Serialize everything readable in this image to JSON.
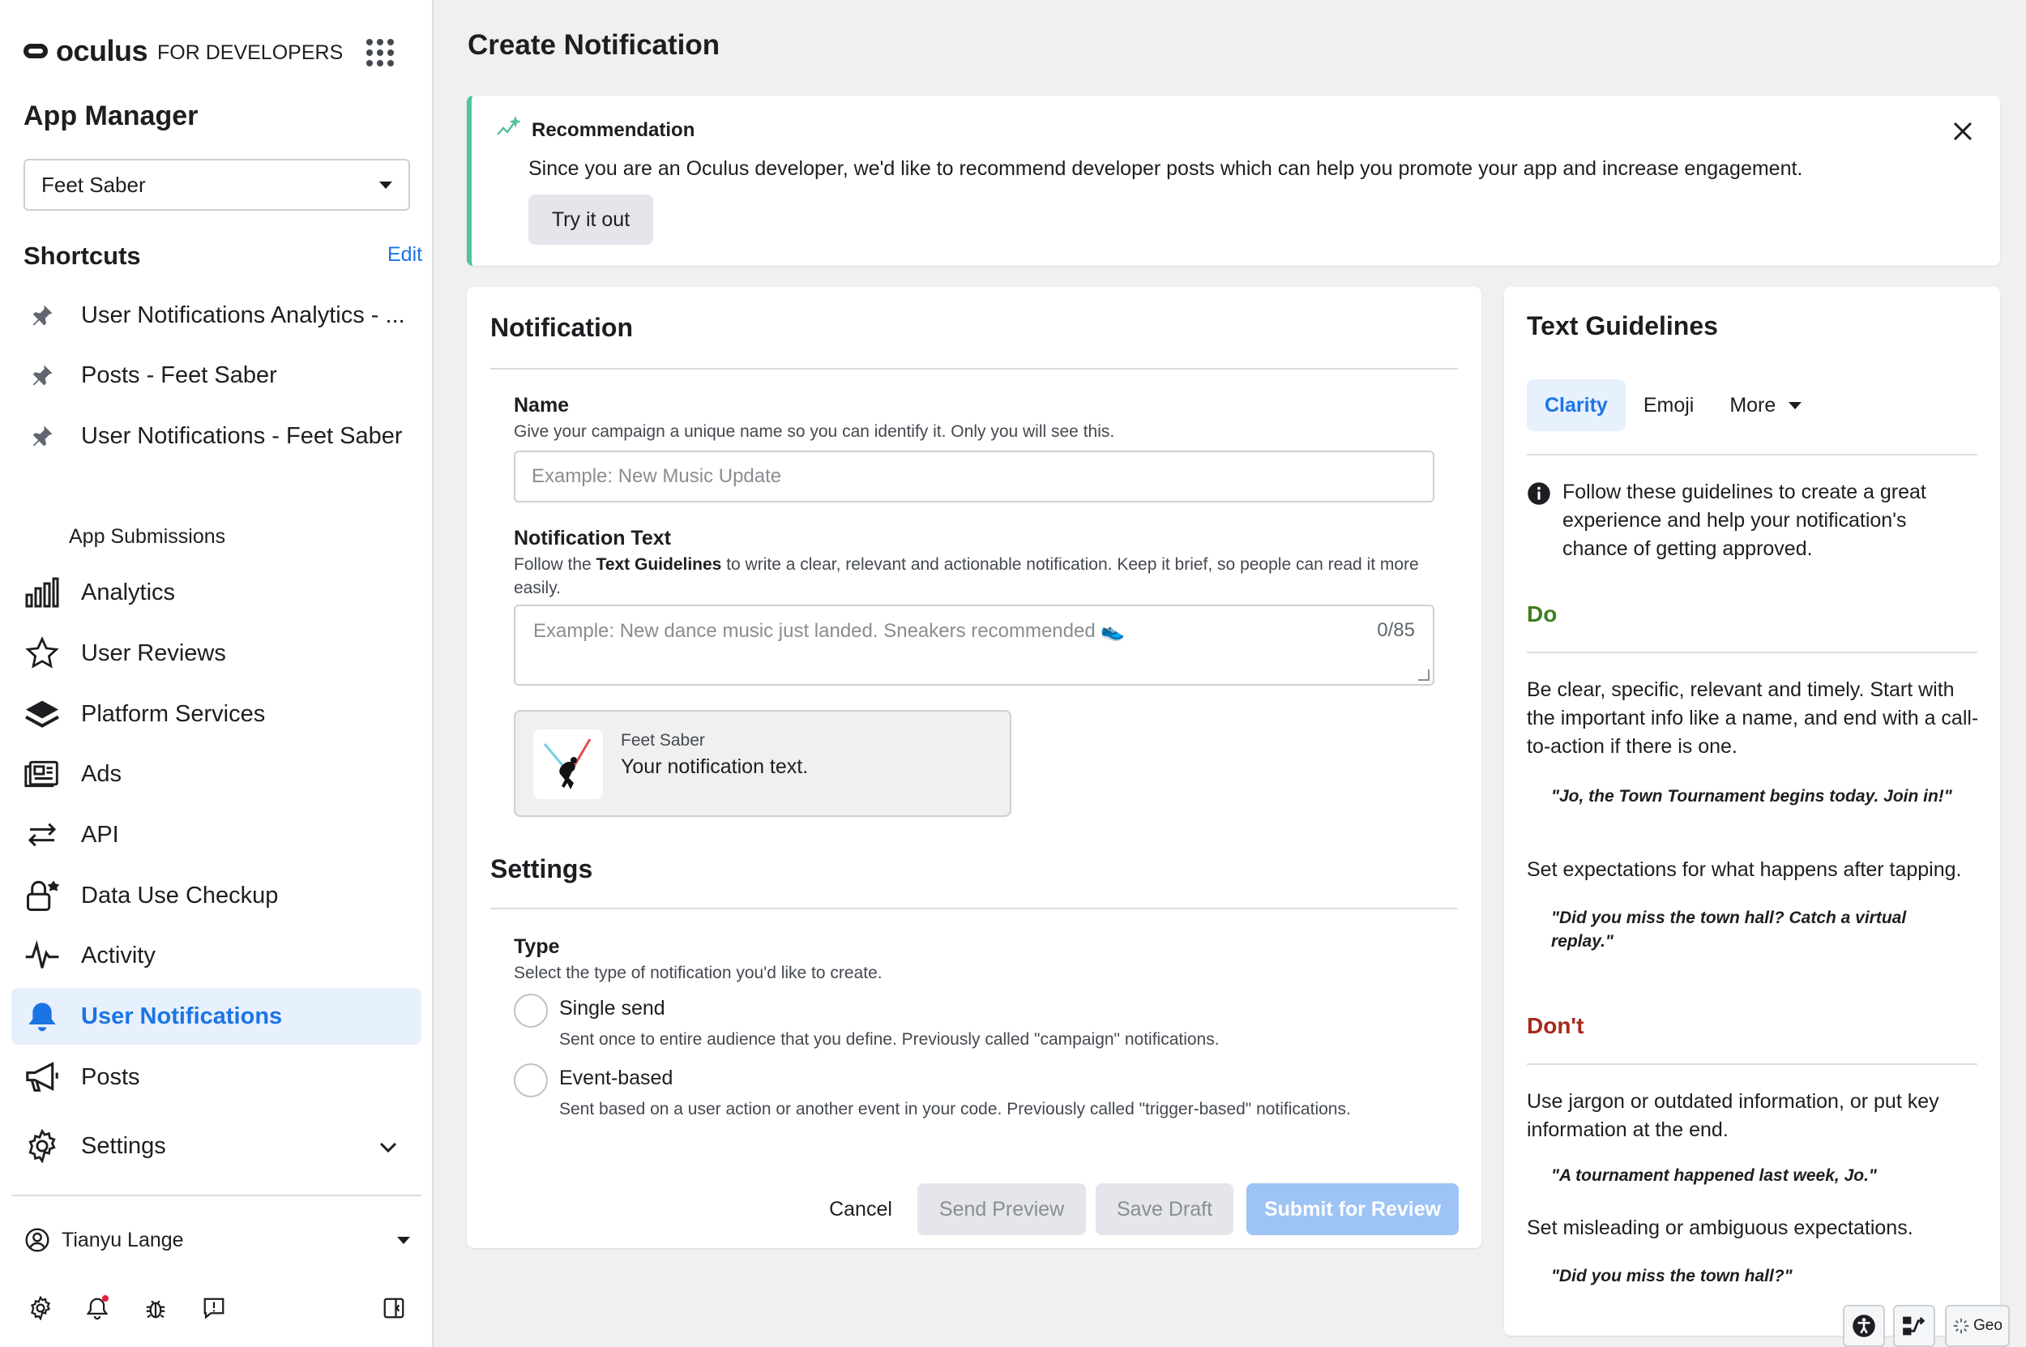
{
  "sidebar": {
    "brand": {
      "name": "oculus",
      "sub": "FOR DEVELOPERS"
    },
    "title": "App Manager",
    "app_select": {
      "value": "Feet Saber"
    },
    "shortcuts": {
      "title": "Shortcuts",
      "edit_label": "Edit",
      "items": [
        {
          "label": "User Notifications Analytics - ...",
          "icon": "pin-icon"
        },
        {
          "label": "Posts - Feet Saber",
          "icon": "pin-icon"
        },
        {
          "label": "User Notifications - Feet Saber",
          "icon": "pin-icon"
        }
      ]
    },
    "sub_item": "App Submissions",
    "nav": [
      {
        "label": "Analytics",
        "icon": "bar-chart-icon"
      },
      {
        "label": "User Reviews",
        "icon": "star-icon"
      },
      {
        "label": "Platform Services",
        "icon": "layers-icon"
      },
      {
        "label": "Ads",
        "icon": "ads-icon"
      },
      {
        "label": "API",
        "icon": "arrows-icon"
      },
      {
        "label": "Data Use Checkup",
        "icon": "lock-icon"
      },
      {
        "label": "Activity",
        "icon": "pulse-icon"
      },
      {
        "label": "User Notifications",
        "icon": "bell-icon",
        "active": true
      },
      {
        "label": "Posts",
        "icon": "megaphone-icon"
      },
      {
        "label": "Settings",
        "icon": "gear-icon"
      }
    ],
    "user": {
      "name": "Tianyu Lange"
    }
  },
  "main": {
    "title": "Create Notification",
    "recommendation": {
      "title": "Recommendation",
      "body": "Since you are an Oculus developer, we'd like to recommend developer posts which can help you promote your app and increase engagement.",
      "button": "Try it out"
    },
    "notification": {
      "title": "Notification",
      "name_label": "Name",
      "name_help": "Give your campaign a unique name so you can identify it. Only you will see this.",
      "name_placeholder": "Example: New Music Update",
      "text_label": "Notification Text",
      "text_help_pre": "Follow the ",
      "text_help_bold": "Text Guidelines",
      "text_help_post": " to write a clear, relevant and actionable notification. Keep it brief, so people can read it more easily.",
      "text_placeholder": "Example: New dance music just landed. Sneakers recommended 👟",
      "text_count": "0/85",
      "preview_app": "Feet Saber",
      "preview_text": "Your notification text."
    },
    "settings": {
      "title": "Settings",
      "type_label": "Type",
      "type_help": "Select the type of notification you'd like to create.",
      "options": [
        {
          "label": "Single send",
          "desc": "Sent once to entire audience that you define. Previously called \"campaign\" notifications."
        },
        {
          "label": "Event-based",
          "desc": "Sent based on a user action or another event in your code. Previously called \"trigger-based\" notifications."
        }
      ]
    },
    "actions": {
      "cancel": "Cancel",
      "send_preview": "Send Preview",
      "save_draft": "Save Draft",
      "submit": "Submit for Review"
    }
  },
  "guidelines": {
    "title": "Text Guidelines",
    "tabs": [
      "Clarity",
      "Emoji",
      "More"
    ],
    "intro": "Follow these guidelines to create a great experience and help your notification's chance of getting approved.",
    "do_title": "Do",
    "do_1": "Be clear, specific, relevant and timely. Start with the important info like a name, and end with a call-to-action if there is one.",
    "do_quote_1": "\"Jo, the Town Tournament begins today. Join in!\"",
    "do_2": "Set expectations for what happens after tapping.",
    "do_quote_2": "\"Did you miss the town hall? Catch a virtual replay.\"",
    "dont_title": "Don't",
    "dont_1": "Use jargon or outdated information, or put key information at the end.",
    "dont_quote_1": "\"A tournament happened last week, Jo.\"",
    "dont_2": "Set misleading or ambiguous expectations.",
    "dont_quote_2": "\"Did you miss the town hall?\""
  },
  "floating": {
    "geo_label": "Geo"
  },
  "colors": {
    "accent": "#1b74e4",
    "active_bg": "#e7f0fd",
    "rec_border": "#52c2a4",
    "do": "#3f7f1f",
    "dont": "#a62a1b"
  }
}
